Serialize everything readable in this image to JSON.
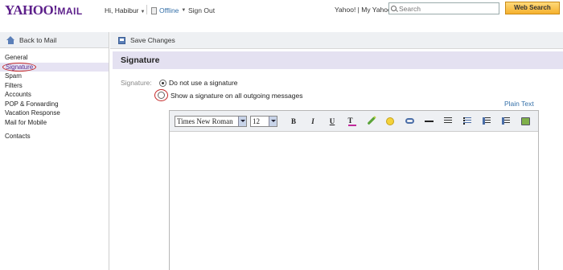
{
  "header": {
    "logo_brand": "YAHOO!",
    "logo_product": "MAIL",
    "greeting": "Hi, Habibur",
    "offline_label": "Offline",
    "signout_label": "Sign Out",
    "top_links": "Yahoo! | My Yahoo!",
    "search_placeholder": "Search",
    "web_search_label": "Web Search"
  },
  "sidebar": {
    "back_label": "Back to Mail",
    "items": [
      {
        "label": "General"
      },
      {
        "label": "Signature"
      },
      {
        "label": "Spam"
      },
      {
        "label": "Filters"
      },
      {
        "label": "Accounts"
      },
      {
        "label": "POP & Forwarding"
      },
      {
        "label": "Vacation Response"
      },
      {
        "label": "Mail for Mobile"
      },
      {
        "label": "Contacts"
      }
    ],
    "active_index": 1
  },
  "toolbar": {
    "save_label": "Save Changes"
  },
  "main": {
    "title": "Signature",
    "signature_label": "Signature:",
    "option_none": "Do not use a signature",
    "option_show": "Show a signature on all outgoing messages",
    "selected_option": "option_none",
    "plain_text_link": "Plain Text"
  },
  "editor": {
    "font_family": "Times New Roman",
    "font_size": "12",
    "bold": "B",
    "italic": "I",
    "underline": "U",
    "text_color": "T"
  },
  "colors": {
    "brand_purple": "#5c1f8a",
    "accent_link": "#3570a8",
    "highlight_circle": "#c42727",
    "title_bar_bg": "#e4e1f1",
    "web_search_button": "#f5b12e"
  }
}
